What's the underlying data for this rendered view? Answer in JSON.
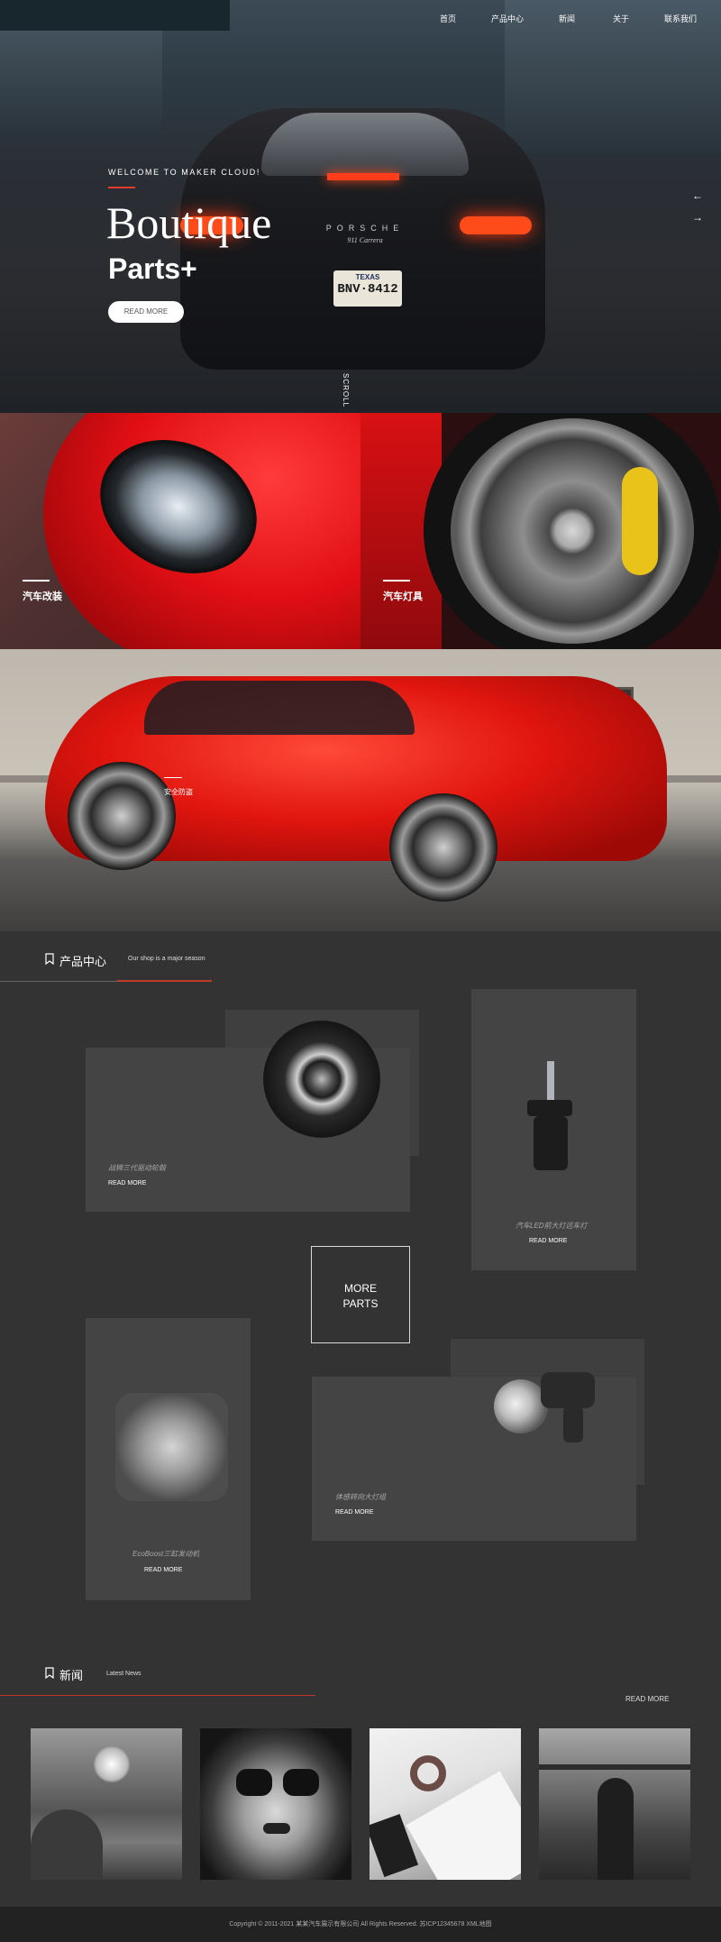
{
  "nav": {
    "items": [
      "首页",
      "产品中心",
      "新闻",
      "关于",
      "联系我们"
    ]
  },
  "hero": {
    "welcome": "WELCOME TO MAKER CLOUD!",
    "title": "Boutique",
    "subtitle": "Parts+",
    "read_more": "READ MORE",
    "arrow_prev": "←",
    "arrow_next": "→",
    "scroll": "SCROLL",
    "plate_state": "TEXAS",
    "plate_number": "BNV·8412",
    "car_brand": "PORSCHE",
    "car_model": "911 Carrera"
  },
  "panels": [
    {
      "label": "汽车改装"
    },
    {
      "label": "汽车灯具"
    }
  ],
  "banner": {
    "caption": "安全防盗"
  },
  "products": {
    "title": "产品中心",
    "subtitle": "Our shop is a major season",
    "more_parts": [
      "MORE",
      "PARTS"
    ],
    "cards": [
      {
        "name": "战狮三代驱动轮毂",
        "more": "READ MORE"
      },
      {
        "name": "汽车LED前大灯远车灯",
        "more": "READ MORE"
      },
      {
        "name": "EcoBoost三缸发动机",
        "more": "READ MORE"
      },
      {
        "name": "体感转向大灯组",
        "more": "READ MORE"
      }
    ]
  },
  "news": {
    "title": "新闻",
    "subtitle": "Latest News",
    "read_more": "READ MORE"
  },
  "footer": {
    "text": "Copyright © 2011-2021 某某汽车展示有限公司 All Rights Reserved.    苏ICP12345678   XML地图"
  },
  "colors": {
    "accent_red": "#c0392b",
    "page_bg": "#333333",
    "card_bg": "#444444"
  }
}
